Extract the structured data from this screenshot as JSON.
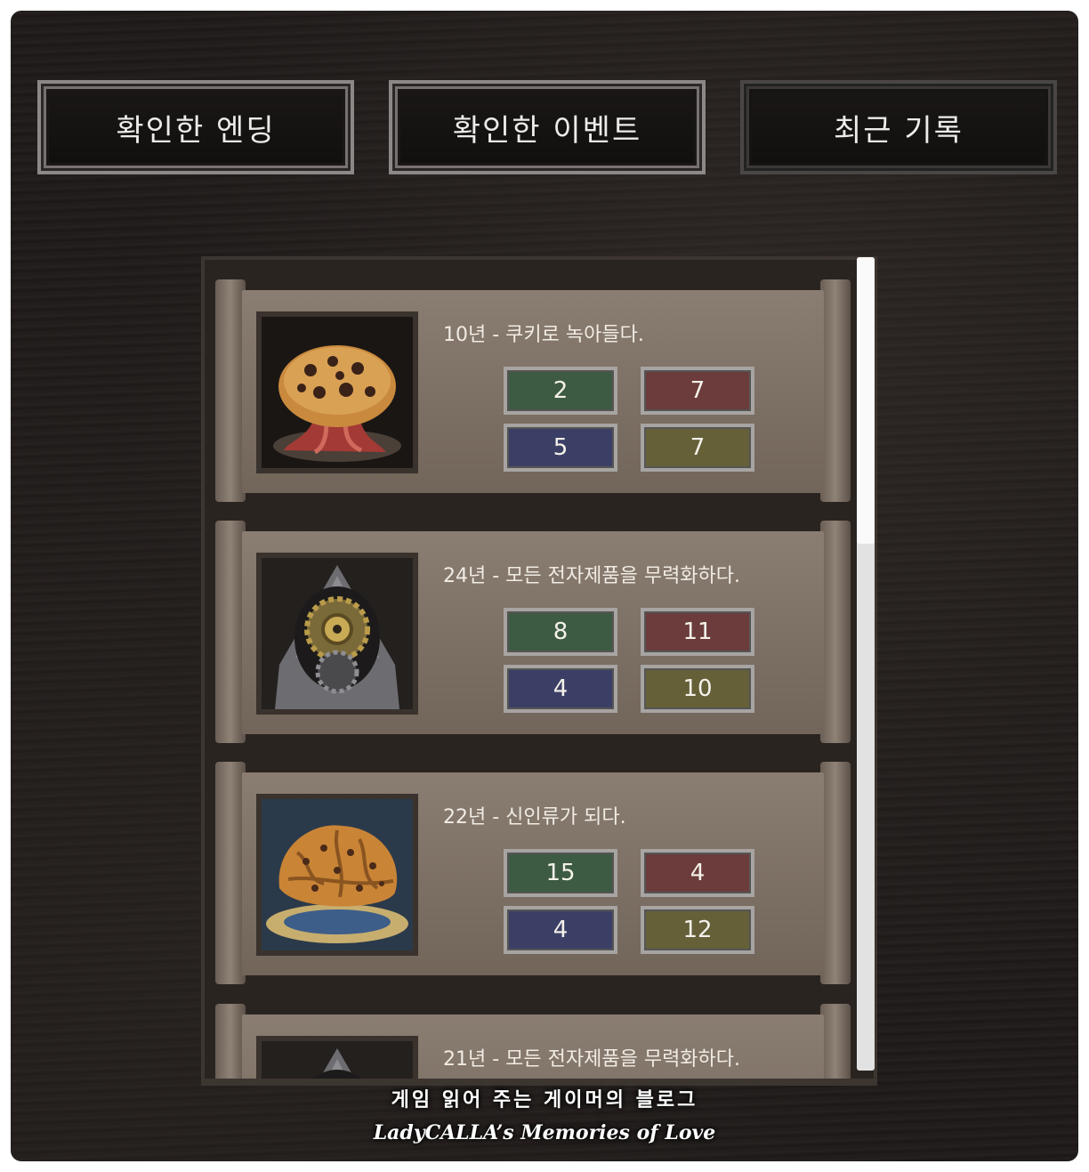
{
  "tabs": [
    {
      "label": "확인한 엔딩",
      "active": true
    },
    {
      "label": "확인한 이벤트",
      "active": true
    },
    {
      "label": "최근 기록",
      "active": false
    }
  ],
  "records": [
    {
      "title": "10년 - 쿠키로 녹아들다.",
      "icon": "melting-cookie-icon",
      "stats": {
        "green": "2",
        "red": "7",
        "blue": "5",
        "yellow": "7"
      }
    },
    {
      "title": "24년 - 모든 전자제품을 무력화하다.",
      "icon": "hooded-gear-icon",
      "stats": {
        "green": "8",
        "red": "11",
        "blue": "4",
        "yellow": "10"
      }
    },
    {
      "title": "22년 - 신인류가 되다.",
      "icon": "cookie-brain-icon",
      "stats": {
        "green": "15",
        "red": "4",
        "blue": "4",
        "yellow": "12"
      }
    },
    {
      "title": "21년 - 모든 전자제품을 무력화하다.",
      "icon": "hooded-gear-icon"
    }
  ],
  "colors": {
    "green": "#3d5b42",
    "red": "#6b3c3b",
    "blue": "#3b3f66",
    "yellow": "#656038"
  },
  "watermark": {
    "line1": "게임 읽어 주는 게이머의 블로그",
    "line2": "LadyCALLA’s Memories of Love"
  }
}
